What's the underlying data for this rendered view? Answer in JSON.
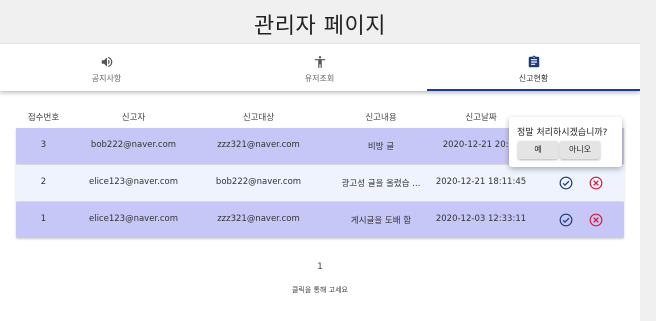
{
  "page": {
    "title": "관리자 페이지"
  },
  "tabs": [
    {
      "label": "공지사항",
      "icon": "speaker-icon",
      "active": false
    },
    {
      "label": "유저조회",
      "icon": "person-icon",
      "active": false
    },
    {
      "label": "신고현황",
      "icon": "clipboard-icon",
      "active": true
    }
  ],
  "table": {
    "headers": [
      "접수번호",
      "신고자",
      "신고대상",
      "신고내용",
      "신고날짜"
    ],
    "rows": [
      {
        "no": "3",
        "reporter": "bob222@naver.com",
        "target": "zzz321@naver.com",
        "content": "비방 글",
        "date": "2020-12-21 20:20",
        "bg": "#c7c7f7"
      },
      {
        "no": "2",
        "reporter": "elice123@naver.com",
        "target": "bob222@naver.com",
        "content": "광고성 글을 올렸습 ...",
        "date": "2020-12-21 18:11:45",
        "bg": "#eef3fd"
      },
      {
        "no": "1",
        "reporter": "elice123@naver.com",
        "target": "zzz321@naver.com",
        "content": "게시글을 도배 함",
        "date": "2020-12-03 12:33:11",
        "bg": "#c7c7f7"
      }
    ]
  },
  "confirm": {
    "question": "정말 처리하시겠습니까?",
    "yes": "예",
    "no": "아니오"
  },
  "pager": {
    "page": "1"
  },
  "hint": "클릭을 통해 고세요",
  "colors": {
    "approve": "#1f3a7a",
    "reject": "#d81b3c",
    "tab_indicator": "#1a3d8f"
  }
}
